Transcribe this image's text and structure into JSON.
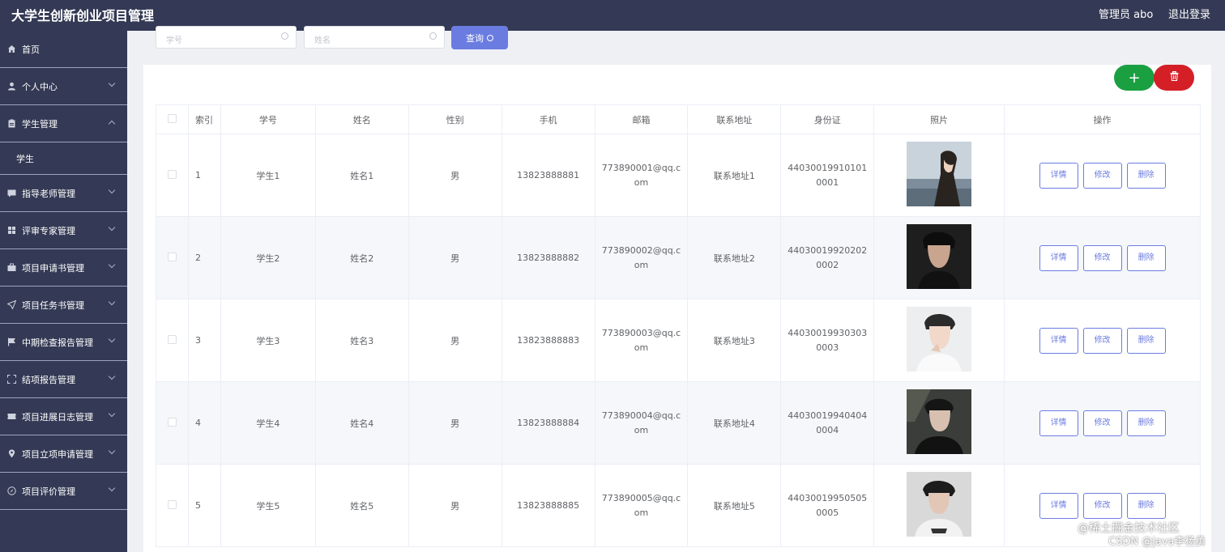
{
  "app": {
    "title": "大学生创新创业项目管理",
    "admin_label": "管理员 abo",
    "logout_label": "退出登录"
  },
  "sidebar": {
    "items": [
      {
        "label": "首页",
        "icon": "home-icon"
      },
      {
        "label": "个人中心",
        "icon": "user-icon"
      },
      {
        "label": "学生管理",
        "icon": "clipboard-icon"
      },
      {
        "label": "指导老师管理",
        "icon": "chat-icon"
      },
      {
        "label": "评审专家管理",
        "icon": "grid-icon"
      },
      {
        "label": "项目申请书管理",
        "icon": "briefcase-icon"
      },
      {
        "label": "项目任务书管理",
        "icon": "send-icon"
      },
      {
        "label": "中期检查报告管理",
        "icon": "flag-icon"
      },
      {
        "label": "结项报告管理",
        "icon": "fullscreen-icon"
      },
      {
        "label": "项目进展日志管理",
        "icon": "ticket-icon"
      },
      {
        "label": "项目立项申请管理",
        "icon": "location-icon"
      },
      {
        "label": "项目评价管理",
        "icon": "compass-icon"
      }
    ],
    "submenu_student": "学生"
  },
  "search": {
    "student_id_placeholder": "学号",
    "name_placeholder": "姓名",
    "query_label": "查询"
  },
  "actions": {
    "add_symbol": "+",
    "delete_symbol": "🗑"
  },
  "table": {
    "headers": [
      "索引",
      "学号",
      "姓名",
      "性别",
      "手机",
      "邮箱",
      "联系地址",
      "身份证",
      "照片",
      "操作"
    ],
    "row_ops": {
      "detail": "详情",
      "edit": "修改",
      "delete": "删除"
    },
    "rows": [
      {
        "index": "1",
        "student_id": "学生1",
        "name": "姓名1",
        "gender": "男",
        "phone": "13823888881",
        "email": "773890001@qq.com",
        "address": "联系地址1",
        "id_card": "440300199101010001"
      },
      {
        "index": "2",
        "student_id": "学生2",
        "name": "姓名2",
        "gender": "男",
        "phone": "13823888882",
        "email": "773890002@qq.com",
        "address": "联系地址2",
        "id_card": "440300199202020002"
      },
      {
        "index": "3",
        "student_id": "学生3",
        "name": "姓名3",
        "gender": "男",
        "phone": "13823888883",
        "email": "773890003@qq.com",
        "address": "联系地址3",
        "id_card": "440300199303030003"
      },
      {
        "index": "4",
        "student_id": "学生4",
        "name": "姓名4",
        "gender": "男",
        "phone": "13823888884",
        "email": "773890004@qq.com",
        "address": "联系地址4",
        "id_card": "440300199404040004"
      },
      {
        "index": "5",
        "student_id": "学生5",
        "name": "姓名5",
        "gender": "男",
        "phone": "13823888885",
        "email": "773890005@qq.com",
        "address": "联系地址5",
        "id_card": "440300199505050005"
      }
    ]
  },
  "watermark": {
    "line1": "@稀土掘金技术社区",
    "line2": "CSDN @java李杨勇"
  },
  "colors": {
    "topbar": "#343a55",
    "primary": "#6b7ce1",
    "add": "#1aa041",
    "danger": "#d41f27"
  }
}
